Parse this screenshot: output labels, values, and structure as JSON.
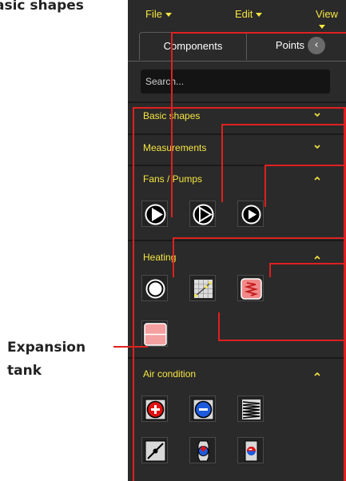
{
  "annotations": {
    "top_label": "asic shapes",
    "expansion_label": "Expansion\ntank"
  },
  "menubar": {
    "items": [
      "File",
      "Edit",
      "View"
    ]
  },
  "tabs": [
    {
      "label": "Components",
      "active": true
    },
    {
      "label": "Points",
      "active": false
    }
  ],
  "collapse_icon": "chevron-left-icon",
  "search": {
    "placeholder": "Search...",
    "value": ""
  },
  "sections": [
    {
      "title": "Basic shapes",
      "expanded": false
    },
    {
      "title": "Measurements",
      "expanded": false
    },
    {
      "title": "Fans / Pumps",
      "expanded": true,
      "items": [
        "pump-icon",
        "pump-outline-icon",
        "fan-icon"
      ]
    },
    {
      "title": "Heating",
      "expanded": true,
      "items": [
        "boiler-circle-icon",
        "heating-curve-icon",
        "heater-coil-icon",
        "expansion-tank-icon"
      ]
    },
    {
      "title": "Air condition",
      "expanded": true,
      "items": [
        "heating-coil-plus-icon",
        "cooling-coil-minus-icon",
        "filter-icon",
        "damper-icon",
        "sensor-probe-icon",
        "room-sensor-icon"
      ]
    }
  ],
  "colors": {
    "accent": "#f5e642",
    "panel": "#2a2a2a",
    "annotation": "#e02020"
  }
}
